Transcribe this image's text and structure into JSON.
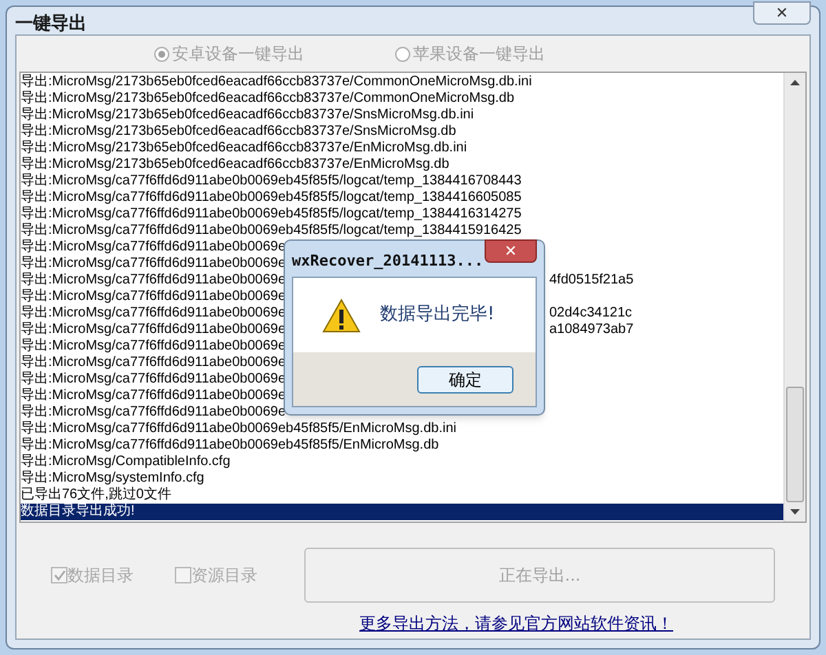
{
  "window": {
    "title": "一键导出",
    "close": "✕"
  },
  "export_modes": [
    {
      "label": "安卓设备一键导出",
      "selected": true
    },
    {
      "label": "苹果设备一键导出",
      "selected": false
    }
  ],
  "log": {
    "rows": [
      {
        "text": "导出:MicroMsg/2173b65eb0fced6eacadf66ccb83737e/CommonOneMicroMsg.db.ini",
        "selected": false
      },
      {
        "text": "导出:MicroMsg/2173b65eb0fced6eacadf66ccb83737e/CommonOneMicroMsg.db",
        "selected": false
      },
      {
        "text": "导出:MicroMsg/2173b65eb0fced6eacadf66ccb83737e/SnsMicroMsg.db.ini",
        "selected": false
      },
      {
        "text": "导出:MicroMsg/2173b65eb0fced6eacadf66ccb83737e/SnsMicroMsg.db",
        "selected": false
      },
      {
        "text": "导出:MicroMsg/2173b65eb0fced6eacadf66ccb83737e/EnMicroMsg.db.ini",
        "selected": false
      },
      {
        "text": "导出:MicroMsg/2173b65eb0fced6eacadf66ccb83737e/EnMicroMsg.db",
        "selected": false
      },
      {
        "text": "导出:MicroMsg/ca77f6ffd6d911abe0b0069eb45f85f5/logcat/temp_1384416708443",
        "selected": false
      },
      {
        "text": "导出:MicroMsg/ca77f6ffd6d911abe0b0069eb45f85f5/logcat/temp_1384416605085",
        "selected": false
      },
      {
        "text": "导出:MicroMsg/ca77f6ffd6d911abe0b0069eb45f85f5/logcat/temp_1384416314275",
        "selected": false
      },
      {
        "text": "导出:MicroMsg/ca77f6ffd6d911abe0b0069eb45f85f5/logcat/temp_1384415916425",
        "selected": false
      },
      {
        "text": "导出:MicroMsg/ca77f6ffd6d911abe0b0069e",
        "selected": false
      },
      {
        "text": "导出:MicroMsg/ca77f6ffd6d911abe0b0069e",
        "selected": false
      },
      {
        "text": "导出:MicroMsg/ca77f6ffd6d911abe0b0069e",
        "tail": "4fd0515f21a5",
        "selected": false
      },
      {
        "text": "导出:MicroMsg/ca77f6ffd6d911abe0b0069e",
        "selected": false
      },
      {
        "text": "导出:MicroMsg/ca77f6ffd6d911abe0b0069e",
        "tail": "02d4c34121c",
        "selected": false
      },
      {
        "text": "导出:MicroMsg/ca77f6ffd6d911abe0b0069e",
        "tail": "a1084973ab7",
        "selected": false
      },
      {
        "text": "导出:MicroMsg/ca77f6ffd6d911abe0b0069e",
        "selected": false
      },
      {
        "text": "导出:MicroMsg/ca77f6ffd6d911abe0b0069e",
        "selected": false
      },
      {
        "text": "导出:MicroMsg/ca77f6ffd6d911abe0b0069e",
        "selected": false
      },
      {
        "text": "导出:MicroMsg/ca77f6ffd6d911abe0b0069e",
        "selected": false
      },
      {
        "text": "导出:MicroMsg/ca77f6ffd6d911abe0b0069e",
        "selected": false
      },
      {
        "text": "导出:MicroMsg/ca77f6ffd6d911abe0b0069eb45f85f5/EnMicroMsg.db.ini",
        "selected": false
      },
      {
        "text": "导出:MicroMsg/ca77f6ffd6d911abe0b0069eb45f85f5/EnMicroMsg.db",
        "selected": false
      },
      {
        "text": "导出:MicroMsg/CompatibleInfo.cfg",
        "selected": false
      },
      {
        "text": "导出:MicroMsg/systemInfo.cfg",
        "selected": false
      },
      {
        "text": "已导出76文件,跳过0文件",
        "selected": false
      },
      {
        "text": "数据目录导出成功!",
        "selected": true
      }
    ]
  },
  "options": [
    {
      "label": "数据目录",
      "checked": true,
      "disabled": true
    },
    {
      "label": "资源目录",
      "checked": false,
      "disabled": true
    }
  ],
  "export_button": {
    "label": "正在导出...",
    "disabled": true
  },
  "link": "更多导出方法，请参见官方网站软件资讯！",
  "dialog": {
    "title": "wxRecover_20141113...",
    "close": "✕",
    "message": "数据导出完毕!",
    "button": "确定"
  }
}
